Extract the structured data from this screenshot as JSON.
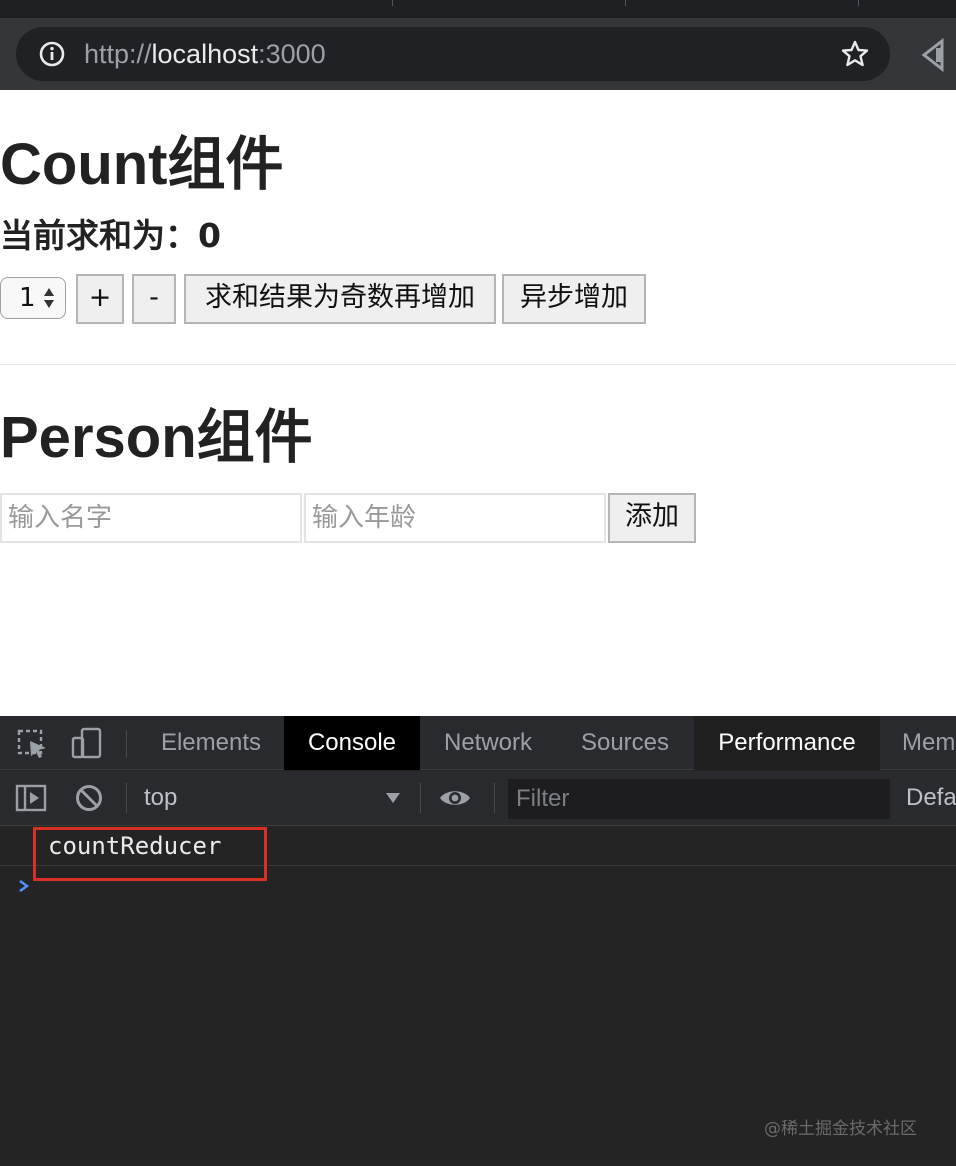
{
  "browser": {
    "url_scheme": "http://",
    "url_host": "localhost",
    "url_port": ":3000"
  },
  "count": {
    "title": "Count组件",
    "sum_text": "当前求和为：0",
    "select_value": "1",
    "buttons": {
      "increment": "+",
      "decrement": "-",
      "odd_increment": "求和结果为奇数再增加",
      "async_increment": "异步增加"
    }
  },
  "person": {
    "title": "Person组件",
    "name_placeholder": "输入名字",
    "age_placeholder": "输入年龄",
    "add_label": "添加"
  },
  "devtools": {
    "tabs": [
      "Elements",
      "Console",
      "Network",
      "Sources",
      "Performance",
      "Mem"
    ],
    "active_tab": "Console",
    "context": "top",
    "filter_placeholder": "Filter",
    "levels_label": "Defa",
    "log_message": "countReducer",
    "highlight_color": "#d93025"
  },
  "watermark": "@稀土掘金技术社区"
}
